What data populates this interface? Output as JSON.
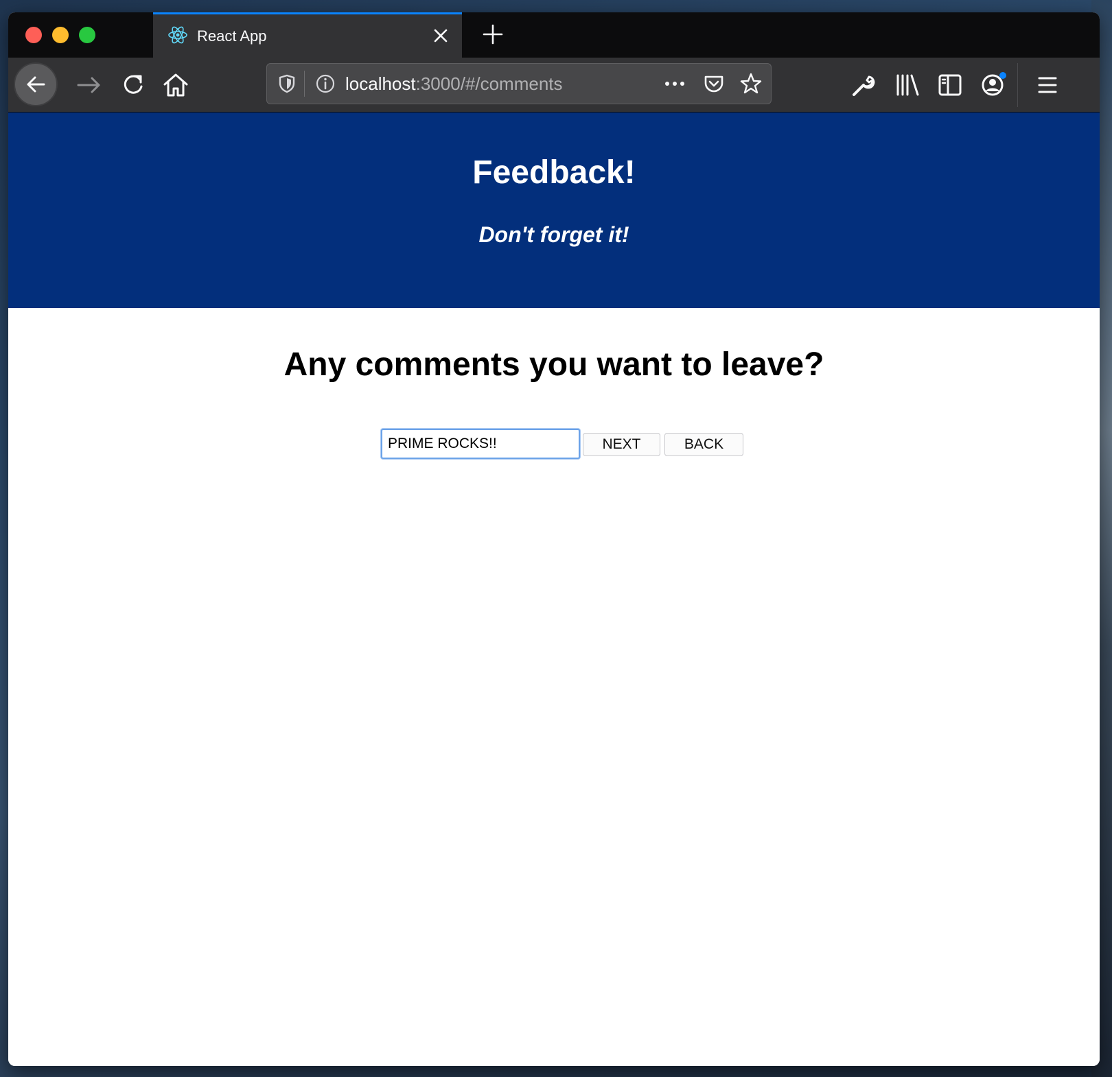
{
  "browser": {
    "tab": {
      "title": "React App",
      "icon": "react-atom-icon"
    },
    "url": {
      "host": "localhost",
      "rest": ":3000/#/comments"
    },
    "toolbar_icons": [
      "back-arrow-icon",
      "forward-arrow-icon",
      "reload-icon",
      "home-icon",
      "shield-icon",
      "info-icon",
      "more-icon",
      "pocket-icon",
      "star-icon",
      "wrench-icon",
      "library-icon",
      "sidebar-icon",
      "account-icon",
      "menu-icon"
    ]
  },
  "header": {
    "title": "Feedback!",
    "subtitle": "Don't forget it!",
    "background_color": "#032f7c"
  },
  "main": {
    "question": "Any comments you want to leave?",
    "comment_value": "PRIME ROCKS!!",
    "next_label": "NEXT",
    "back_label": "BACK"
  },
  "colors": {
    "accent": "#0a84ff",
    "header_bg": "#032f7c"
  }
}
